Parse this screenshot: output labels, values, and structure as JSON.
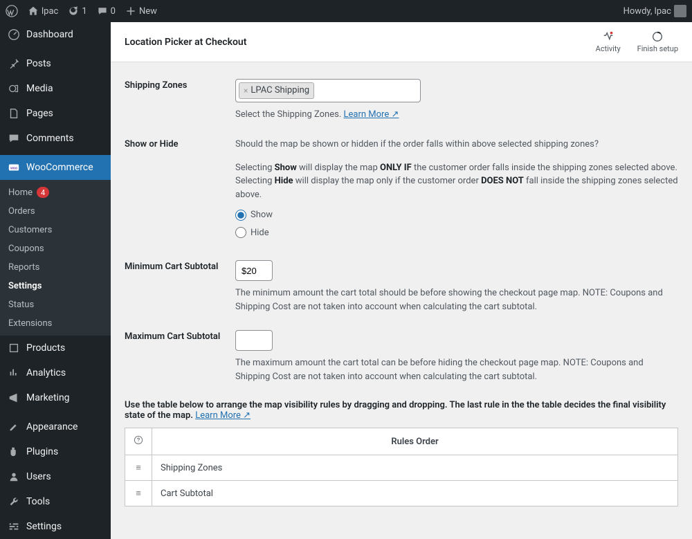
{
  "adminbar": {
    "site_name": "lpac",
    "update_count": "1",
    "comment_count": "0",
    "new_label": "New",
    "howdy": "Howdy, lpac"
  },
  "sidebar": {
    "dashboard": "Dashboard",
    "posts": "Posts",
    "media": "Media",
    "pages": "Pages",
    "comments": "Comments",
    "woocommerce": "WooCommerce",
    "woo_sub": {
      "home": "Home",
      "home_count": "4",
      "orders": "Orders",
      "customers": "Customers",
      "coupons": "Coupons",
      "reports": "Reports",
      "settings": "Settings",
      "status": "Status",
      "extensions": "Extensions"
    },
    "products": "Products",
    "analytics": "Analytics",
    "marketing": "Marketing",
    "appearance": "Appearance",
    "plugins": "Plugins",
    "users": "Users",
    "tools": "Tools",
    "settings": "Settings"
  },
  "header": {
    "title": "Location Picker at Checkout",
    "activity": "Activity",
    "finish_setup": "Finish setup"
  },
  "fields": {
    "shipping_zones": {
      "label": "Shipping Zones",
      "tag": "LPAC Shipping",
      "help_prefix": "Select the Shipping Zones. ",
      "learn_more": "Learn More"
    },
    "show_hide": {
      "label": "Show or Hide",
      "intro": "Should the map be shown or hidden if the order falls within above selected shipping zones?",
      "l1a": "Selecting ",
      "l1b": "Show",
      "l1c": " will display the map ",
      "l1d": "ONLY IF",
      "l1e": " the customer order falls inside the shipping zones selected above.",
      "l2a": "Selecting ",
      "l2b": "Hide",
      "l2c": " will display the map only if the customer order ",
      "l2d": "DOES NOT",
      "l2e": " fall inside the shipping zones selected above.",
      "opt_show": "Show",
      "opt_hide": "Hide"
    },
    "min_cart": {
      "label": "Minimum Cart Subtotal",
      "value": "$20",
      "desc": "The minimum amount the cart total should be before showing the checkout page map. NOTE: Coupons and Shipping Cost are not taken into account when calculating the cart subtotal."
    },
    "max_cart": {
      "label": "Maximum Cart Subtotal",
      "value": "",
      "desc": "The maximum amount the cart total can be before hiding the checkout page map. NOTE: Coupons and Shipping Cost are not taken into account when calculating the cart subtotal."
    }
  },
  "rules": {
    "intro_a": "Use the table below to arrange the map visibility rules by dragging and dropping. The last rule in the the table decides the final visibility state of the map. ",
    "learn_more": "Learn More",
    "header_icon": "?",
    "header_title": "Rules Order",
    "row1": "Shipping Zones",
    "row2": "Cart Subtotal"
  }
}
